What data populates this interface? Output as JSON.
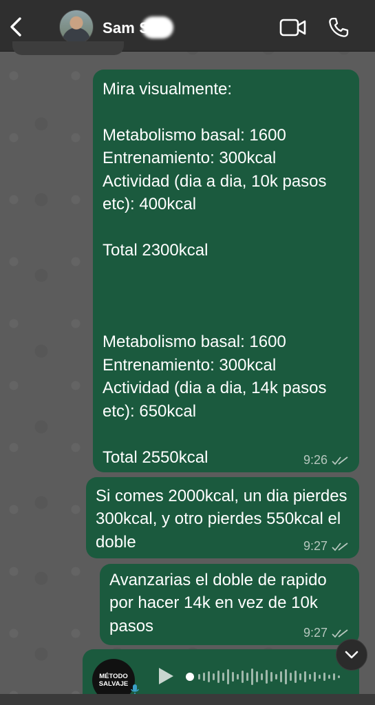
{
  "header": {
    "contact_name": "Sam S",
    "icons": [
      "back-chevron-icon",
      "video-call-icon",
      "phone-call-icon"
    ]
  },
  "messages": [
    {
      "text": "Mira visualmente:\n\nMetabolismo basal: 1600\nEntrenamiento: 300kcal\nActividad (dia a dia, 10k pasos etc): 400kcal\n\nTotal 2300kcal\n\n\n\nMetabolismo basal: 1600\nEntrenamiento: 300kcal\nActividad (dia a dia, 14k pasos etc): 650kcal\n\nTotal 2550kcal",
      "time": "9:26"
    },
    {
      "text": "Si comes 2000kcal, un dia pierdes 300kcal, y otro pierdes 550kcal el doble",
      "time": "9:27"
    },
    {
      "text": "Avanzarias el doble de rapido por hacer 14k en vez de 10k pasos",
      "time": "9:27"
    }
  ],
  "voice_note": {
    "avatar_text": "MÉTODO SALVAJE"
  },
  "colors": {
    "header_bg": "#2f2f2f",
    "bubble_outgoing": "#1b5a3e",
    "chat_bg": "#5c5c5c",
    "meta_text": "#b6c7be"
  }
}
